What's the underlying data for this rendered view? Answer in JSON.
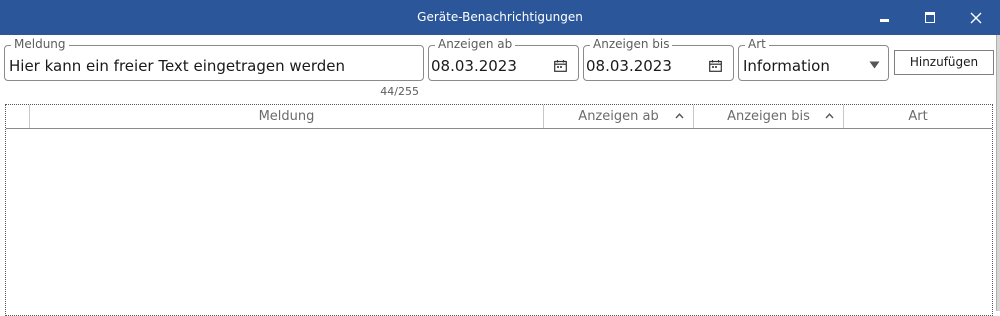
{
  "window": {
    "title": "Geräte-Benachrichtigungen",
    "controls": {
      "minimize": "minimize-icon",
      "maximize": "maximize-icon",
      "close": "close-icon"
    },
    "accent_color": "#2b579a"
  },
  "form": {
    "meldung": {
      "label": "Meldung",
      "value": "Hier kann ein freier Text eingetragen werden",
      "counter": "44/255"
    },
    "anzeigen_ab": {
      "label": "Anzeigen ab",
      "value": "08.03.2023",
      "icon": "calendar-icon"
    },
    "anzeigen_bis": {
      "label": "Anzeigen bis",
      "value": "08.03.2023",
      "icon": "calendar-icon"
    },
    "art": {
      "label": "Art",
      "value": "Information",
      "icon": "dropdown-arrow-icon"
    },
    "add_button": "Hinzufügen"
  },
  "grid": {
    "columns": [
      {
        "label": ""
      },
      {
        "label": "Meldung"
      },
      {
        "label": "Anzeigen ab",
        "sort": "sort-ascending-icon"
      },
      {
        "label": "Anzeigen bis",
        "sort": "sort-ascending-icon"
      },
      {
        "label": "Art"
      }
    ],
    "rows": []
  }
}
